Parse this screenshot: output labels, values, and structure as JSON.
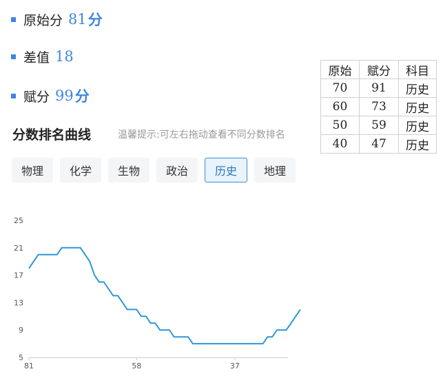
{
  "stats": {
    "original": {
      "label": "原始分",
      "value": "81",
      "unit": "分"
    },
    "diff": {
      "label": "差值",
      "value": "18"
    },
    "scaled": {
      "label": "赋分",
      "value": "99",
      "unit": "分"
    }
  },
  "section": {
    "title": "分数排名曲线",
    "hint": "温馨提示:可左右拖动查看不同分数排名"
  },
  "tabs": [
    {
      "label": "物理",
      "active": false
    },
    {
      "label": "化学",
      "active": false
    },
    {
      "label": "生物",
      "active": false
    },
    {
      "label": "政治",
      "active": false
    },
    {
      "label": "历史",
      "active": true
    },
    {
      "label": "地理",
      "active": false
    }
  ],
  "table": {
    "headers": [
      "原始",
      "赋分",
      "科目"
    ],
    "rows": [
      [
        "70",
        "91",
        "历史"
      ],
      [
        "60",
        "73",
        "历史"
      ],
      [
        "50",
        "59",
        "历史"
      ],
      [
        "40",
        "47",
        "历史"
      ]
    ]
  },
  "colors": {
    "accent": "#3f86e0",
    "line": "#2f95d8",
    "active_tab_border": "#3b8fd0"
  },
  "chart_data": {
    "type": "line",
    "title": "",
    "xlabel": "",
    "ylabel": "",
    "x_tick_labels": [
      "81",
      "58",
      "37"
    ],
    "y_ticks": [
      5,
      9,
      13,
      17,
      21,
      25
    ],
    "ylim": [
      5,
      25
    ],
    "x_reversed": true,
    "grid": false,
    "series": [
      {
        "x": [
          81,
          80,
          79,
          78,
          77,
          76,
          75,
          74,
          73,
          72,
          71,
          70,
          69,
          68,
          67,
          66,
          65,
          64,
          63,
          62,
          61,
          60,
          59,
          58,
          57,
          56,
          55,
          54,
          53,
          52,
          51,
          50,
          49,
          48,
          47,
          46,
          45,
          44,
          43,
          42,
          41,
          40,
          39,
          38,
          37,
          36,
          35,
          34,
          33,
          32,
          31,
          30,
          29,
          28,
          27,
          26,
          25,
          24,
          23
        ],
        "values": [
          18,
          19,
          20,
          20,
          20,
          20,
          20,
          21,
          21,
          21,
          21,
          21,
          20,
          19,
          17,
          16,
          16,
          15,
          14,
          14,
          13,
          12,
          12,
          12,
          11,
          11,
          10,
          10,
          9,
          9,
          9,
          8,
          8,
          8,
          8,
          7,
          7,
          7,
          7,
          7,
          7,
          7,
          7,
          7,
          7,
          7,
          7,
          7,
          7,
          7,
          7,
          8,
          8,
          9,
          9,
          9,
          10,
          11,
          12
        ]
      }
    ]
  }
}
